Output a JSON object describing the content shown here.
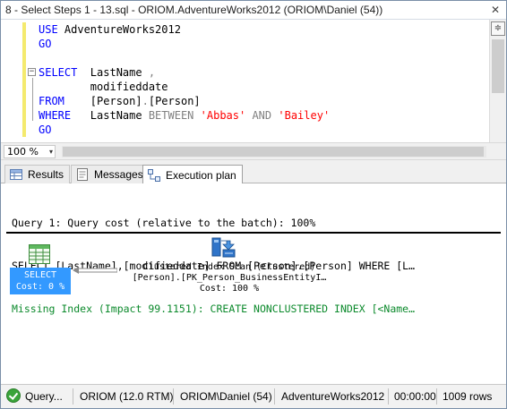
{
  "window": {
    "title": "8 - Select Steps 1 - 13.sql - ORIOM.AdventureWorks2012 (ORIOM\\Daniel (54))",
    "close_glyph": "✕"
  },
  "editor": {
    "lines": [
      {
        "parts": [
          {
            "t": "USE",
            "c": "kw"
          },
          {
            "t": " AdventureWorks2012",
            "c": ""
          }
        ]
      },
      {
        "parts": [
          {
            "t": "GO",
            "c": "kw"
          }
        ]
      },
      {
        "parts": [
          {
            "t": "",
            "c": ""
          }
        ]
      },
      {
        "parts": [
          {
            "t": "SELECT",
            "c": "kw"
          },
          {
            "t": "  LastName ",
            "c": ""
          },
          {
            "t": ",",
            "c": "op"
          }
        ]
      },
      {
        "parts": [
          {
            "t": "        modifieddate",
            "c": ""
          }
        ]
      },
      {
        "parts": [
          {
            "t": "FROM",
            "c": "kw"
          },
          {
            "t": "    [Person]",
            "c": ""
          },
          {
            "t": ".",
            "c": "op"
          },
          {
            "t": "[Person]",
            "c": ""
          }
        ]
      },
      {
        "parts": [
          {
            "t": "WHERE",
            "c": "kw"
          },
          {
            "t": "   LastName ",
            "c": ""
          },
          {
            "t": "BETWEEN",
            "c": "op"
          },
          {
            "t": " ",
            "c": ""
          },
          {
            "t": "'Abbas'",
            "c": "str"
          },
          {
            "t": " ",
            "c": ""
          },
          {
            "t": "AND",
            "c": "op"
          },
          {
            "t": " ",
            "c": ""
          },
          {
            "t": "'Bailey'",
            "c": "str"
          }
        ]
      },
      {
        "parts": [
          {
            "t": "GO",
            "c": "kw"
          }
        ]
      }
    ],
    "collapse_glyph": "−"
  },
  "zoom": {
    "value": "100 %",
    "arrow": "▾"
  },
  "tabs": [
    {
      "label": "Results",
      "icon": "results-grid-icon",
      "active": false
    },
    {
      "label": "Messages",
      "icon": "messages-icon",
      "active": false
    },
    {
      "label": "Execution plan",
      "icon": "execution-plan-icon",
      "active": true
    }
  ],
  "plan": {
    "query_line": "Query 1: Query cost (relative to the batch): 100%",
    "sql_line": "SELECT [LastName],[modifieddate] FROM [Person].[Person] WHERE [L…",
    "missing_index_line": "Missing Index (Impact 99.1151): CREATE NONCLUSTERED INDEX [<Name…",
    "select_node": {
      "label": "SELECT",
      "cost": "Cost: 0 %",
      "icon": "select-operator-icon"
    },
    "scan_node": {
      "title": "Clustered Index Scan (Clustered)",
      "object": "[Person].[PK_Person_BusinessEntityI…",
      "cost": "Cost: 100 %",
      "icon": "clustered-index-scan-icon"
    },
    "colors": {
      "missing_index": "#0c8a2c",
      "selected_node": "#3399ff"
    }
  },
  "status": {
    "state": "Query...",
    "server": "ORIOM (12.0 RTM)",
    "user": "ORIOM\\Daniel (54)",
    "database": "AdventureWorks2012",
    "elapsed": "00:00:00",
    "rows": "1009 rows"
  }
}
